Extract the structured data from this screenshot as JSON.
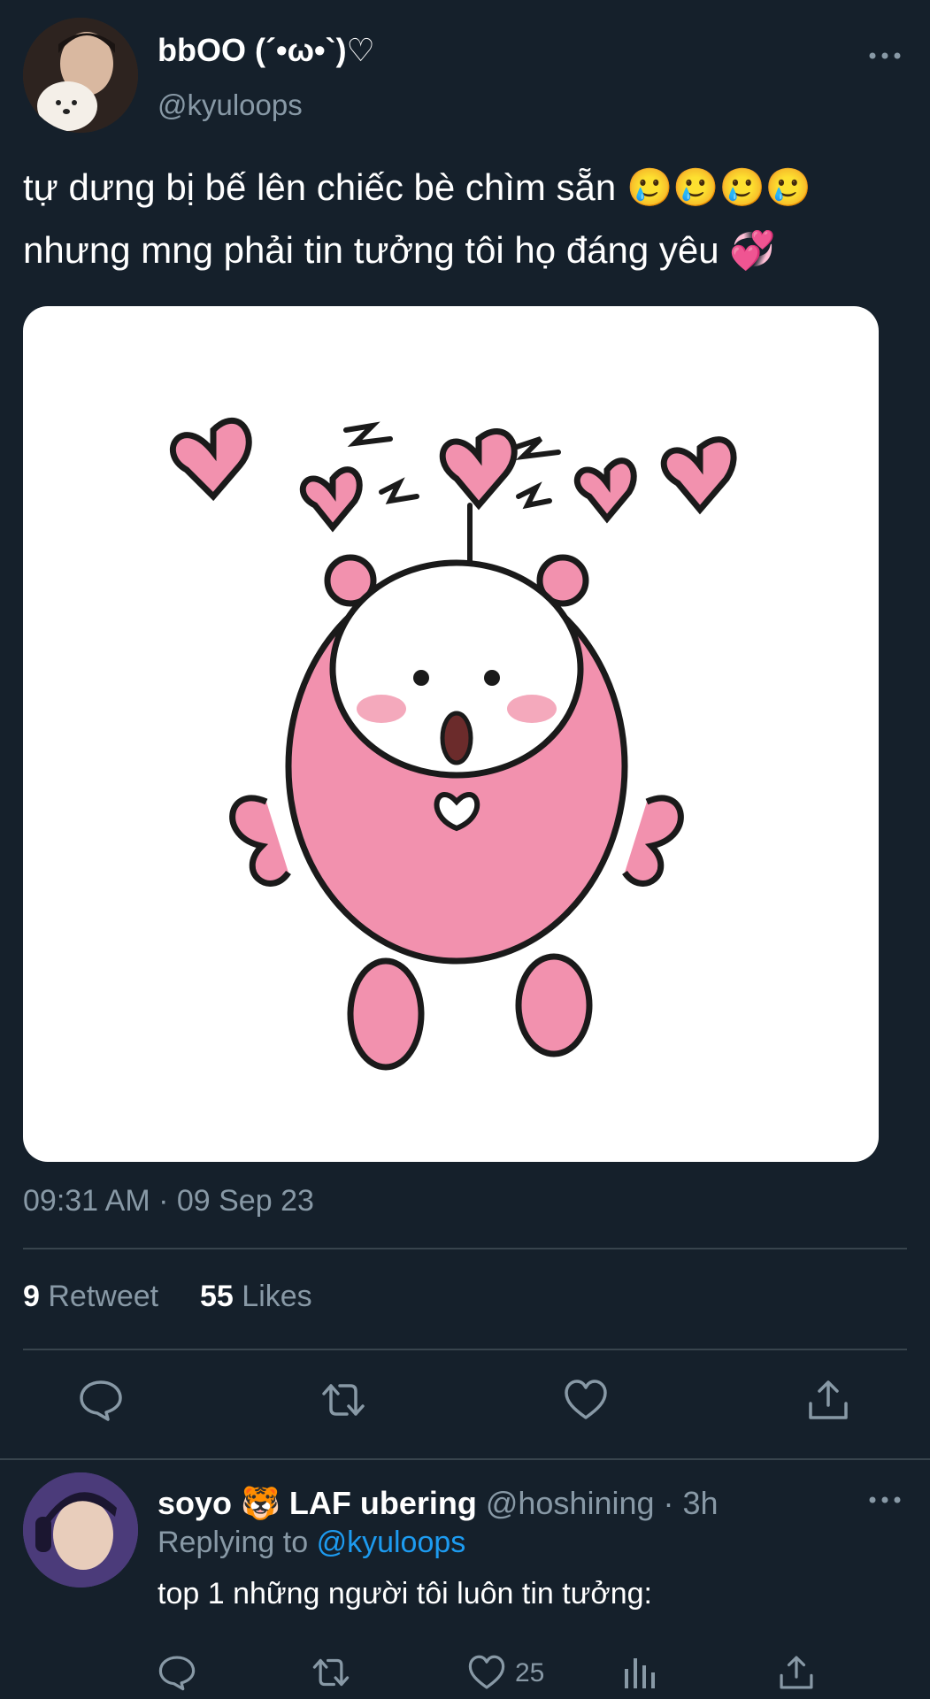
{
  "tweet": {
    "display_name": "bbOO (´•ω•`)♡",
    "handle": "@kyuloops",
    "text_line1": "tự dưng bị bế lên chiếc bè chìm sẵn 🥲🥲🥲🥲",
    "text_line2": "nhưng mng phải tin tưởng tôi họ đáng yêu 💞",
    "timestamp": "09:31 AM · 09 Sep 23",
    "retweet_count": "9",
    "retweet_label": "Retweet",
    "like_count": "55",
    "like_label": "Likes"
  },
  "reply": {
    "display_name": "soyo 🐯 LAF ubering",
    "handle_time": "@hoshining · 3h",
    "replying_label": "Replying to",
    "replying_mention": "@kyuloops",
    "text": "top 1 những người tôi luôn tin tưởng:",
    "like_count": "25"
  },
  "icons": {
    "more": "more-horizontal-icon",
    "reply": "comment-bubble-icon",
    "retweet": "retweet-icon",
    "like": "heart-icon",
    "share": "share-upload-icon",
    "analytics": "analytics-bars-icon"
  },
  "colors": {
    "background": "#15202b",
    "secondary_text": "#8899a6",
    "link": "#1d9bf0",
    "divider": "#38444d",
    "sticker_pink": "#f291ae"
  }
}
